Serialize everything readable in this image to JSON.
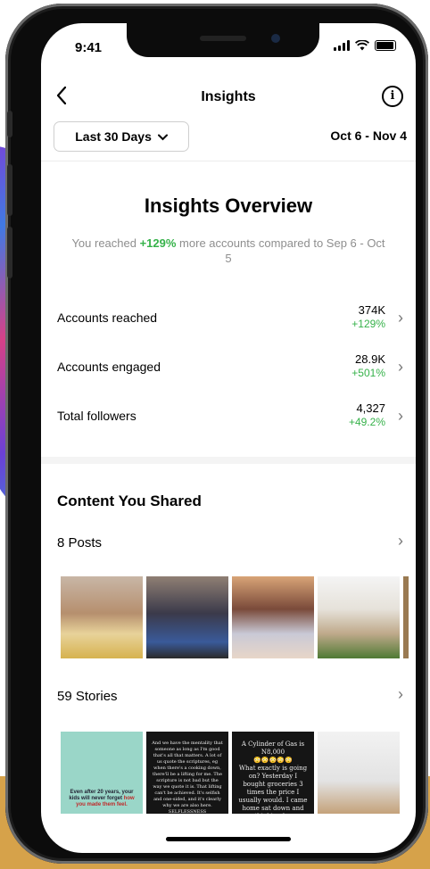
{
  "status": {
    "time": "9:41"
  },
  "header": {
    "title": "Insights"
  },
  "filter": {
    "label": "Last 30 Days",
    "date_range": "Oct 6 - Nov 4"
  },
  "overview": {
    "title": "Insights Overview",
    "sub_prefix": "You reached ",
    "sub_highlight": "+129%",
    "sub_suffix": " more accounts compared to Sep 6 - Oct 5"
  },
  "metrics": [
    {
      "label": "Accounts reached",
      "value": "374K",
      "change": "+129%"
    },
    {
      "label": "Accounts engaged",
      "value": "28.9K",
      "change": "+501%"
    },
    {
      "label": "Total followers",
      "value": "4,327",
      "change": "+49.2%"
    }
  ],
  "content": {
    "title": "Content You Shared",
    "posts_label": "8 Posts",
    "stories_label": "59 Stories"
  },
  "stories_text": {
    "s1_main": "Even after 20 years, your kids will never forget ",
    "s1_highlight": "how you made them feel.",
    "s2": "And we have the mentality that someone as long as I'm good that's all that matters. A lot of us quote the scriptures, eg when there's a cooking down, there'll be a lifting for me. The scripture is not bad but the way we quote it is. That lifting can't be achieved. It's selfish and one-sided, and it's clearly why we are also here. SELFLESSNESS",
    "s3_title": "A Cylinder of Gas is N8,000",
    "s3_emoji": "😳😳😳😳😳",
    "s3_body": "What exactly is going on? Yesterday I bought groceries 3 times the price I usually would. I came home sat down and was thinking how on earth I paid what I paid. How is the average Nigerian living, by average i mean"
  },
  "colors": {
    "accent_green": "#36b24a",
    "text_gray": "#8e8e8e"
  },
  "icons": [
    "back-arrow-icon",
    "info-icon",
    "chevron-down-icon",
    "chevron-right-icon",
    "signal-icon",
    "wifi-icon",
    "battery-icon"
  ]
}
